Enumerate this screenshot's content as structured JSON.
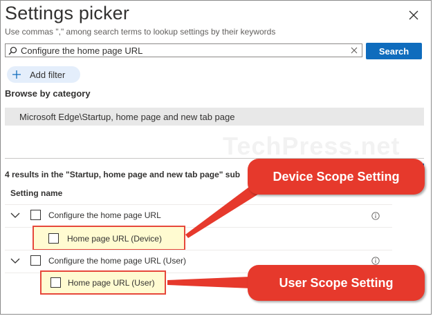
{
  "panel": {
    "title": "Settings picker",
    "subtitle": "Use commas \",\" among search terms to lookup settings by their keywords"
  },
  "search": {
    "value": "Configure the home page URL",
    "button_label": "Search"
  },
  "filter": {
    "add_label": "Add filter"
  },
  "browse": {
    "heading": "Browse by category",
    "category": "Microsoft Edge\\Startup, home page and new tab page"
  },
  "watermark": "TechPress.net",
  "results": {
    "summary": "4 results in the \"Startup, home page and new tab page\" sub",
    "column_header": "Setting name",
    "rows": [
      {
        "label": "Configure the home page URL"
      },
      {
        "label": "Home page URL (Device)"
      },
      {
        "label": "Configure the home page URL (User)"
      },
      {
        "label": "Home page URL (User)"
      }
    ]
  },
  "callouts": {
    "device": "Device Scope Setting",
    "user": "User Scope Setting"
  },
  "colors": {
    "accent": "#0f6cbd",
    "callout": "#e6392c",
    "highlight": "#fffbd1"
  }
}
